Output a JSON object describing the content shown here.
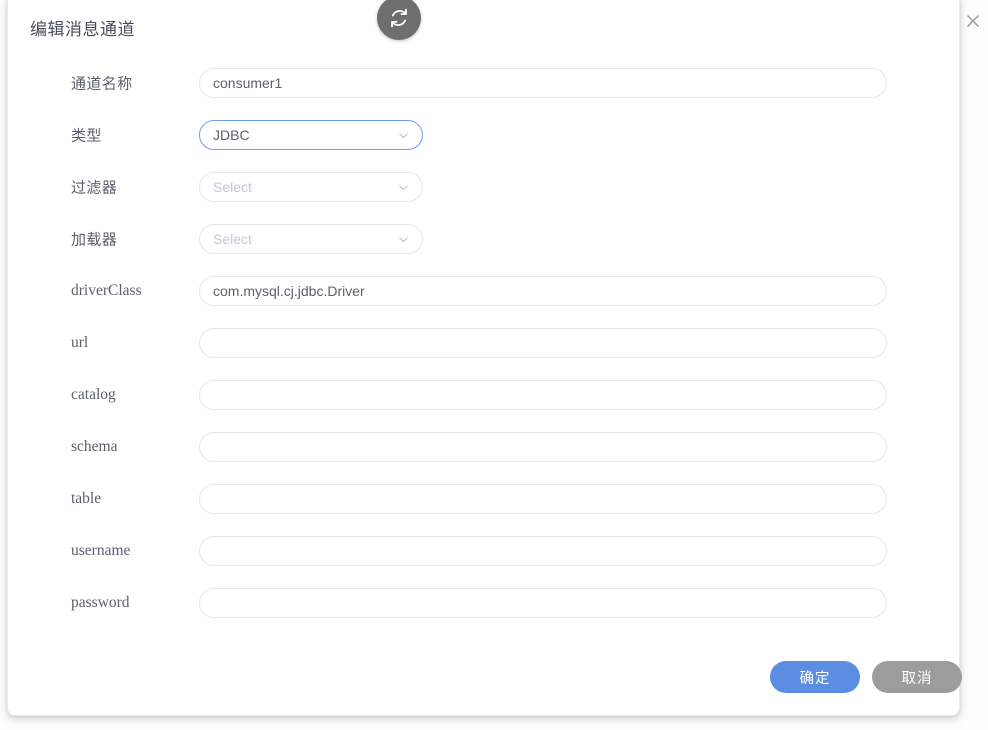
{
  "dialog": {
    "title": "编辑消息通道",
    "refresh_icon": "refresh-icon",
    "close_icon": "close-icon"
  },
  "colors": {
    "accent_blue": "#5b8de2",
    "cancel_gray": "#9c9c9c",
    "focus_border": "#6f9ee8",
    "field_border": "#e6e7eb",
    "refresh_bg": "#6e6e6e",
    "label_text": "#5a5f6b",
    "value_text": "#5b6069",
    "placeholder_text": "#c2c8d4"
  },
  "form": {
    "fields": [
      {
        "label": "通道名称",
        "label_script": "cjk",
        "control": "input",
        "width": "wide",
        "value": "consumer1",
        "placeholder": "",
        "focused": false,
        "name": "channel-name"
      },
      {
        "label": "类型",
        "label_script": "cjk",
        "control": "select",
        "width": "small",
        "value": "JDBC",
        "placeholder": "",
        "focused": true,
        "name": "type"
      },
      {
        "label": "过滤器",
        "label_script": "cjk",
        "control": "select",
        "width": "small",
        "value": "",
        "placeholder": "Select",
        "focused": false,
        "name": "filter"
      },
      {
        "label": "加载器",
        "label_script": "cjk",
        "control": "select",
        "width": "small",
        "value": "",
        "placeholder": "Select",
        "focused": false,
        "name": "loader"
      },
      {
        "label": "driverClass",
        "label_script": "latin",
        "control": "input",
        "width": "wide",
        "value": "com.mysql.cj.jdbc.Driver",
        "placeholder": "",
        "focused": false,
        "name": "driver-class"
      },
      {
        "label": "url",
        "label_script": "latin",
        "control": "input",
        "width": "wide",
        "value": "",
        "placeholder": "",
        "focused": false,
        "name": "url"
      },
      {
        "label": "catalog",
        "label_script": "latin",
        "control": "input",
        "width": "wide",
        "value": "",
        "placeholder": "",
        "focused": false,
        "name": "catalog"
      },
      {
        "label": "schema",
        "label_script": "latin",
        "control": "input",
        "width": "wide",
        "value": "",
        "placeholder": "",
        "focused": false,
        "name": "schema"
      },
      {
        "label": "table",
        "label_script": "latin",
        "control": "input",
        "width": "wide",
        "value": "",
        "placeholder": "",
        "focused": false,
        "name": "table"
      },
      {
        "label": "username",
        "label_script": "latin",
        "control": "input",
        "width": "wide",
        "value": "",
        "placeholder": "",
        "focused": false,
        "name": "username"
      },
      {
        "label": "password",
        "label_script": "latin",
        "control": "input",
        "width": "wide",
        "value": "",
        "placeholder": "",
        "focused": false,
        "name": "password"
      }
    ]
  },
  "footer": {
    "confirm_label": "确定",
    "cancel_label": "取消"
  }
}
